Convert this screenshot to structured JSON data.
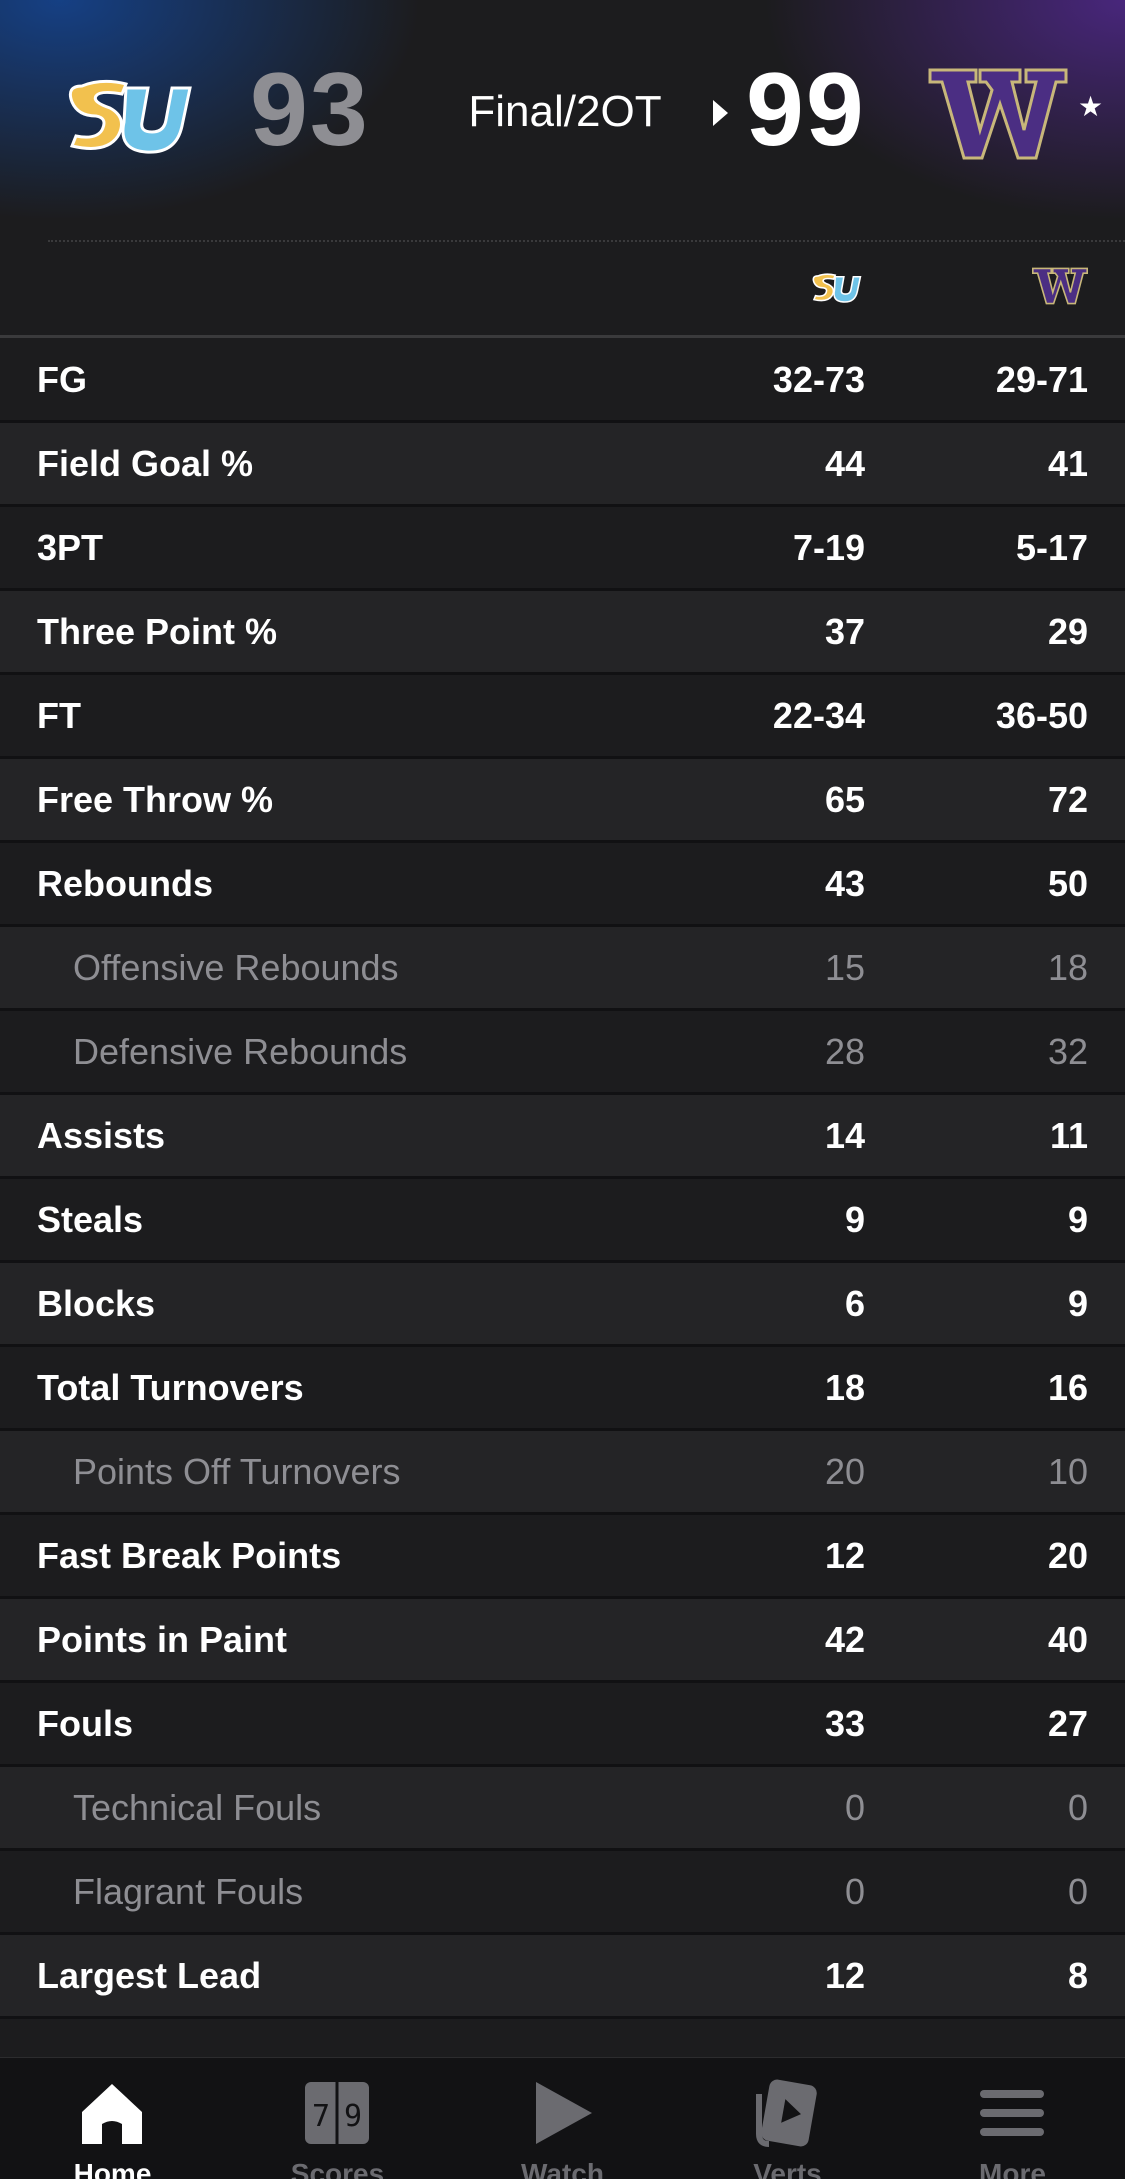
{
  "game": {
    "away_team": {
      "logo": "southern-university-logo",
      "score": "93"
    },
    "home_team": {
      "logo": "washington-huskies-logo",
      "score": "99"
    },
    "status": "Final/2OT",
    "winner_indicator": "right-arrow-icon",
    "favorite_marker": "★"
  },
  "stats": [
    {
      "label": "FG",
      "away": "32-73",
      "home": "29-71",
      "sub": false
    },
    {
      "label": "Field Goal %",
      "away": "44",
      "home": "41",
      "sub": false
    },
    {
      "label": "3PT",
      "away": "7-19",
      "home": "5-17",
      "sub": false
    },
    {
      "label": "Three Point %",
      "away": "37",
      "home": "29",
      "sub": false
    },
    {
      "label": "FT",
      "away": "22-34",
      "home": "36-50",
      "sub": false
    },
    {
      "label": "Free Throw %",
      "away": "65",
      "home": "72",
      "sub": false
    },
    {
      "label": "Rebounds",
      "away": "43",
      "home": "50",
      "sub": false
    },
    {
      "label": "Offensive Rebounds",
      "away": "15",
      "home": "18",
      "sub": true
    },
    {
      "label": "Defensive Rebounds",
      "away": "28",
      "home": "32",
      "sub": true
    },
    {
      "label": "Assists",
      "away": "14",
      "home": "11",
      "sub": false
    },
    {
      "label": "Steals",
      "away": "9",
      "home": "9",
      "sub": false
    },
    {
      "label": "Blocks",
      "away": "6",
      "home": "9",
      "sub": false
    },
    {
      "label": "Total Turnovers",
      "away": "18",
      "home": "16",
      "sub": false
    },
    {
      "label": "Points Off Turnovers",
      "away": "20",
      "home": "10",
      "sub": true
    },
    {
      "label": "Fast Break Points",
      "away": "12",
      "home": "20",
      "sub": false
    },
    {
      "label": "Points in Paint",
      "away": "42",
      "home": "40",
      "sub": false
    },
    {
      "label": "Fouls",
      "away": "33",
      "home": "27",
      "sub": false
    },
    {
      "label": "Technical Fouls",
      "away": "0",
      "home": "0",
      "sub": true
    },
    {
      "label": "Flagrant Fouls",
      "away": "0",
      "home": "0",
      "sub": true
    },
    {
      "label": "Largest Lead",
      "away": "12",
      "home": "8",
      "sub": false
    }
  ],
  "tabbar": [
    {
      "label": "Home",
      "icon": "home-icon",
      "active": true
    },
    {
      "label": "Scores",
      "icon": "scores-icon",
      "active": false
    },
    {
      "label": "Watch",
      "icon": "play-icon",
      "active": false
    },
    {
      "label": "Verts",
      "icon": "verts-icon",
      "active": false
    },
    {
      "label": "More",
      "icon": "menu-icon",
      "active": false
    }
  ],
  "colors": {
    "background": "#1c1c1e",
    "row_alt": "#242426",
    "muted_text": "#8e8e93",
    "washington_purple": "#4b2e83",
    "washington_gold": "#c8b77a",
    "southern_blue": "#6ec3e8",
    "southern_gold": "#f2c14e"
  }
}
